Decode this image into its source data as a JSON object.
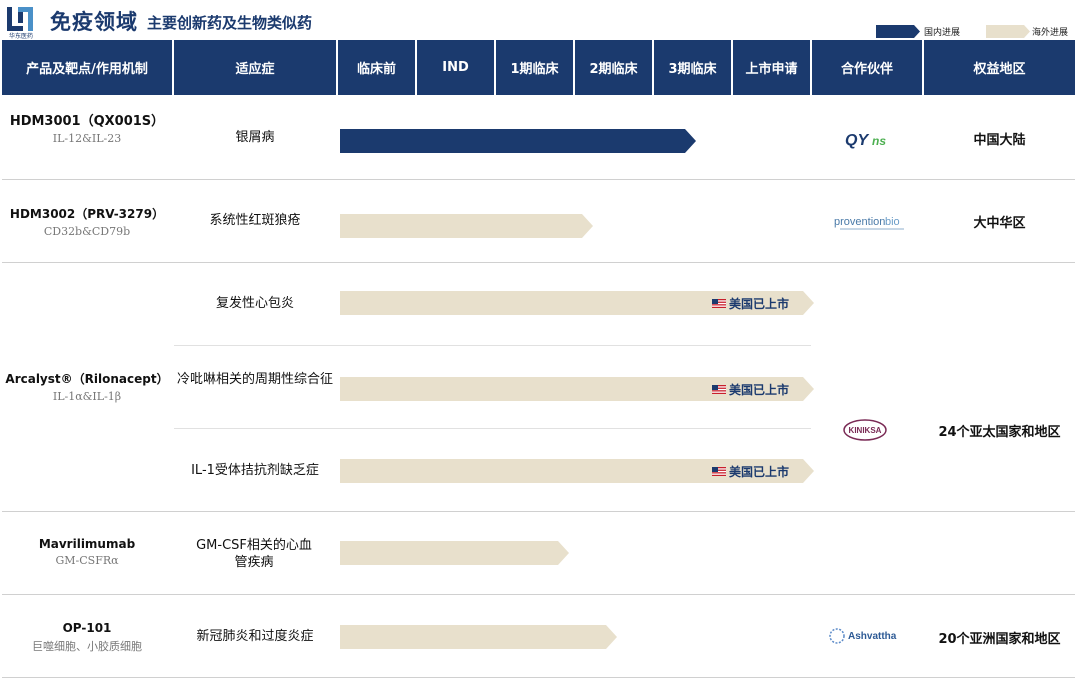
{
  "header": {
    "logo_text": "华东医药",
    "title_main": "免疫领域",
    "title_sub": "主要创新药及生物类似药",
    "legend": {
      "domestic": "国内进展",
      "overseas": "海外进展"
    }
  },
  "colors": {
    "domestic": "#1b3a6e",
    "overseas": "#e8e0cc",
    "header_bg": "#1b3a6e"
  },
  "columns": [
    "产品及靶点/作用机制",
    "适应症",
    "临床前",
    "IND",
    "1期临床",
    "2期临床",
    "3期临床",
    "上市申请",
    "合作伙伴",
    "权益地区"
  ],
  "rows": [
    {
      "product": "HDM3001（QX001S）",
      "target": "IL-12&IL-23",
      "indication": "银屑病",
      "progress": "domestic",
      "end_phase": 4.5,
      "partner": "QYns",
      "region": "中国大陆"
    },
    {
      "product": "HDM3002（PRV-3279）",
      "target": "CD32b&CD79b",
      "indication": "系统性红斑狼疮",
      "progress": "overseas",
      "end_phase": 3.2,
      "partner": "proventionbio",
      "region": "大中华区"
    },
    {
      "product": "Arcalyst®（Rilonacept）",
      "target": "IL-1α&IL-1β",
      "indications": [
        {
          "name": "复发性心包炎",
          "end_phase": 6.0,
          "status": "美国已上市"
        },
        {
          "name": "冷吡啉相关的周期性综合征",
          "end_phase": 6.0,
          "status": "美国已上市"
        },
        {
          "name": "IL-1受体拮抗剂缺乏症",
          "end_phase": 6.0,
          "status": "美国已上市"
        }
      ],
      "progress": "overseas",
      "partner": "KINIKSA",
      "region": "24个亚太国家和地区"
    },
    {
      "product": "Mavrilimumab",
      "target": "GM-CSFRα",
      "indication": "GM-CSF相关的心血管疾病",
      "progress": "overseas",
      "end_phase": 2.9,
      "partner": "",
      "region": ""
    },
    {
      "product": "OP-101",
      "target": "巨噬细胞、小胶质细胞",
      "indication": "新冠肺炎和过度炎症",
      "progress": "overseas",
      "end_phase": 3.5,
      "partner": "Ashvattha",
      "region": "20个亚洲国家和地区"
    }
  ]
}
